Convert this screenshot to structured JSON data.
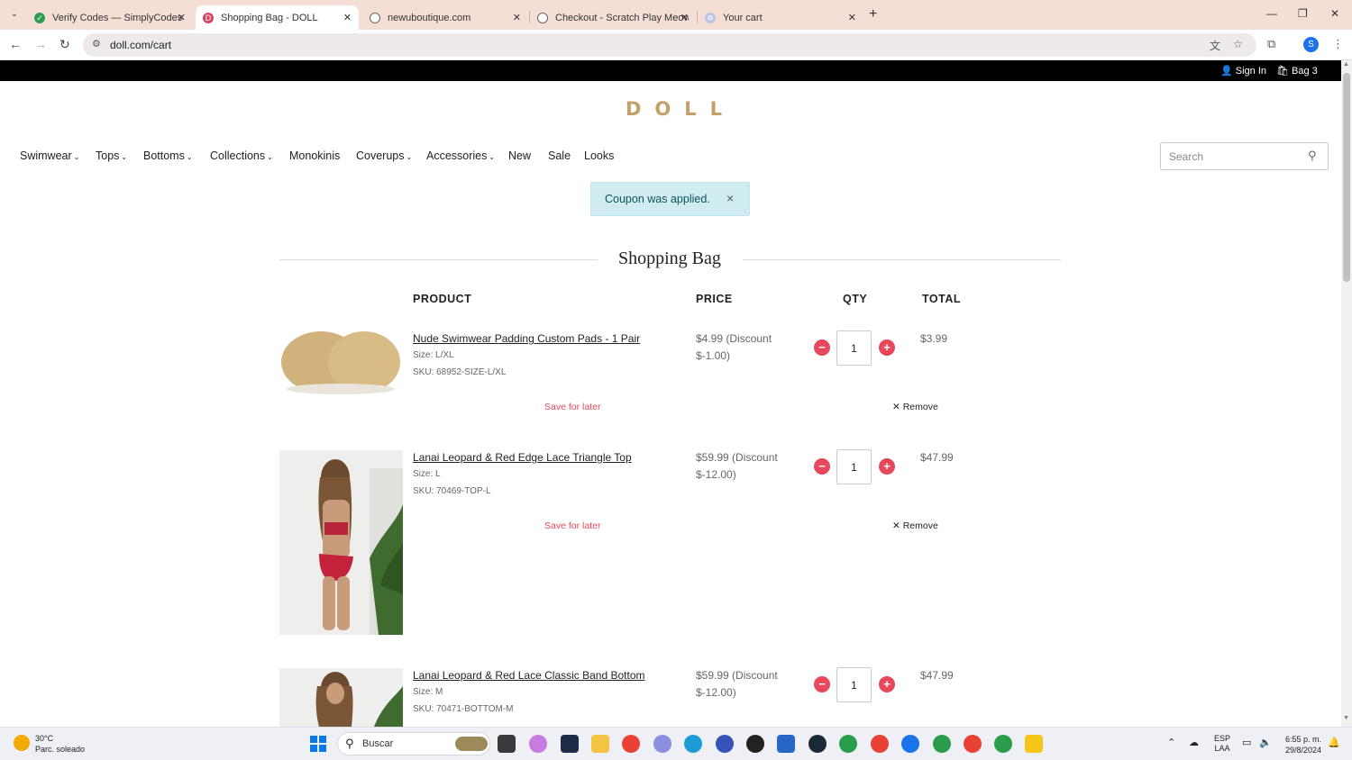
{
  "browser": {
    "tabs": [
      {
        "title": "Verify Codes — SimplyCodes",
        "favicon": "check-leaf-icon",
        "active": false
      },
      {
        "title": "Shopping Bag - DOLL",
        "favicon": "doll-logo-icon",
        "active": true
      },
      {
        "title": "newuboutique.com",
        "favicon": "globe-icon",
        "active": false
      },
      {
        "title": "Checkout - Scratch Play Meow",
        "favicon": "globe-icon",
        "active": false
      },
      {
        "title": "Your cart",
        "favicon": "gear-flower-icon",
        "active": false
      }
    ],
    "url": "doll.com/cart",
    "profile_initial": "S"
  },
  "site": {
    "topbar": {
      "sign_in": "Sign In",
      "bag": "Bag 3"
    },
    "logo": "DOLL",
    "menu": [
      {
        "label": "Swimwear",
        "dropdown": true
      },
      {
        "label": "Tops",
        "dropdown": true
      },
      {
        "label": "Bottoms",
        "dropdown": true
      },
      {
        "label": "Collections",
        "dropdown": true
      },
      {
        "label": "Monokinis",
        "dropdown": false
      },
      {
        "label": "Coverups",
        "dropdown": true
      },
      {
        "label": "Accessories",
        "dropdown": true
      },
      {
        "label": "New",
        "dropdown": false
      },
      {
        "label": "Sale",
        "dropdown": false
      },
      {
        "label": "Looks",
        "dropdown": false
      }
    ],
    "search_placeholder": "Search",
    "alert": {
      "message": "Coupon was applied.",
      "close": "×"
    },
    "heading": "Shopping Bag",
    "columns": {
      "product": "PRODUCT",
      "price": "PRICE",
      "qty": "QTY",
      "total": "TOTAL"
    },
    "items": [
      {
        "name": "Nude Swimwear Padding Custom Pads - 1 Pair",
        "size": "Size: L/XL",
        "sku": "SKU: 68952-SIZE-L/XL",
        "price": "$4.99 (Discount $-1.00)",
        "qty": "1",
        "total": "$3.99",
        "save_for_later": "Save for later",
        "remove": "Remove"
      },
      {
        "name": "Lanai Leopard & Red Edge Lace Triangle Top",
        "size": "Size: L",
        "sku": "SKU: 70469-TOP-L",
        "price": "$59.99 (Discount $-12.00)",
        "qty": "1",
        "total": "$47.99",
        "save_for_later": "Save for later",
        "remove": "Remove"
      },
      {
        "name": "Lanai Leopard & Red Lace Classic Band Bottom",
        "size": "Size: M",
        "sku": "SKU: 70471-BOTTOM-M",
        "price": "$59.99 (Discount $-12.00)",
        "qty": "1",
        "total": "$47.99"
      }
    ]
  },
  "taskbar": {
    "weather_temp": "30°C",
    "weather_desc": "Parc. soleado",
    "search_label": "Buscar",
    "lang_top": "ESP",
    "lang_bottom": "LAA",
    "time": "6:55 p. m.",
    "date": "29/8/2024"
  },
  "colors": {
    "accent": "#e8485c",
    "logo": "#c4a06a",
    "alert_bg": "#d1ecf1",
    "tabbar": "#f4ded6"
  }
}
